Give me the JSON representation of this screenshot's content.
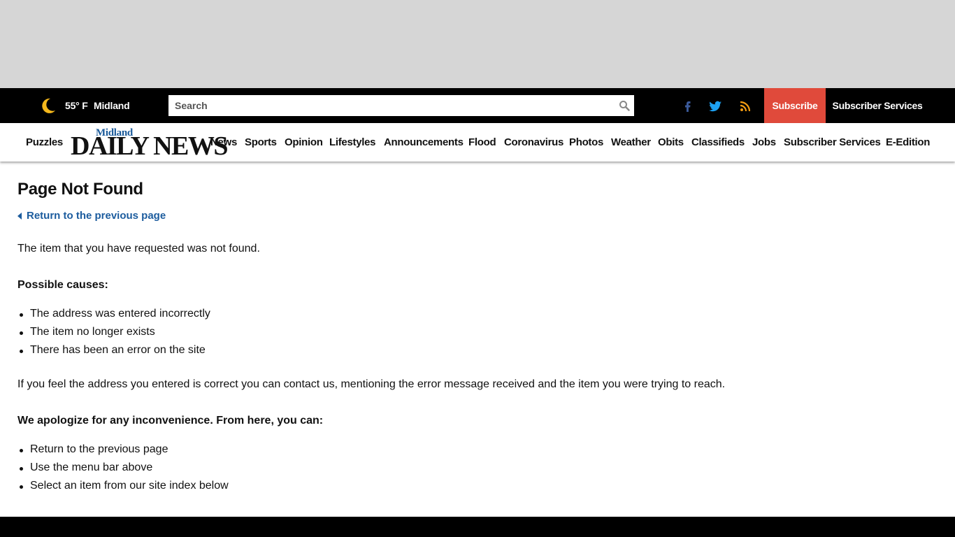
{
  "topbar": {
    "weather_icon": "moon-icon",
    "temperature": "55° F",
    "city": "Midland",
    "search_placeholder": "Search",
    "social_icons": [
      "facebook-icon",
      "twitter-icon",
      "rss-icon"
    ],
    "subscribe_label": "Subscribe",
    "subscriber_services_label": "Subscriber Services",
    "subscribe_color": "#e04a3b"
  },
  "logo": {
    "top": "Midland",
    "main": "DAILY NEWS"
  },
  "nav": {
    "items": [
      "Puzzles",
      "News",
      "Sports",
      "Opinion",
      "Lifestyles",
      "Announcements",
      "Flood",
      "Coronavirus",
      "Photos",
      "Weather",
      "Obits",
      "Classifieds",
      "Jobs",
      "Subscriber Services",
      "E-Edition"
    ]
  },
  "main": {
    "title": "Page Not Found",
    "back_link": "Return to the previous page",
    "not_found_text": "The item that you have requested was not found.",
    "causes_heading": "Possible causes:",
    "causes": [
      "The address was entered incorrectly",
      "The item no longer exists",
      "There has been an error on the site"
    ],
    "contact_text": "If you feel the address you entered is correct you can contact us, mentioning the error message received and the item you were trying to reach.",
    "apology_heading": "We apologize for any inconvenience. From here, you can:",
    "options": [
      "Return to the previous page",
      "Use the menu bar above",
      "Select an item from our site index below"
    ]
  },
  "colors": {
    "link": "#1c5c9e",
    "topbar_bg": "#000000",
    "ad_band_bg": "#d6d6d6"
  }
}
